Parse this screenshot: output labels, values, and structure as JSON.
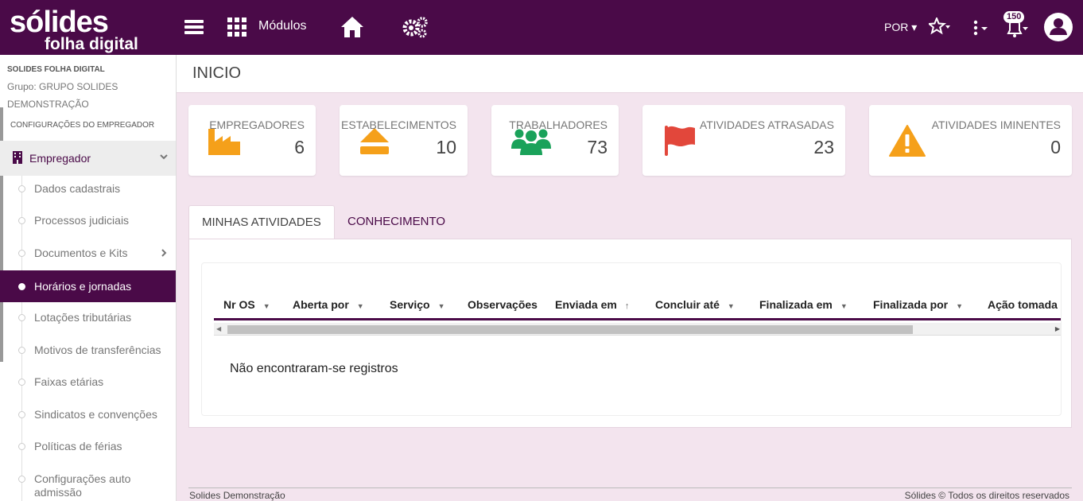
{
  "header": {
    "logo_line1": "sólides",
    "logo_line2": "folha digital",
    "modules_label": "Módulos",
    "language": "POR",
    "notifications_count": "150"
  },
  "sidebar": {
    "company": "SOLIDES FOLHA DIGITAL",
    "group": "Grupo: GRUPO SOLIDES DEMONSTRAÇÃO",
    "config_label": "CONFIGURAÇÕES DO EMPREGADOR",
    "section_label": "Empregador",
    "items": [
      {
        "label": "Dados cadastrais"
      },
      {
        "label": "Processos judiciais"
      },
      {
        "label": "Documentos e Kits"
      },
      {
        "label": "Horários e jornadas"
      },
      {
        "label": "Lotações tributárias"
      },
      {
        "label": "Motivos de transferências"
      },
      {
        "label": "Faixas etárias"
      },
      {
        "label": "Sindicatos e convenções"
      },
      {
        "label": "Políticas de férias"
      },
      {
        "label": "Configurações auto admissão"
      }
    ]
  },
  "page": {
    "title": "INICIO"
  },
  "cards": [
    {
      "title": "EMPREGADORES",
      "value": "6",
      "icon": "factory-icon",
      "color": "#f5a01a"
    },
    {
      "title": "ESTABELECIMENTOS",
      "value": "10",
      "icon": "eject-icon",
      "color": "#f5a01a"
    },
    {
      "title": "TRABALHADORES",
      "value": "73",
      "icon": "users-icon",
      "color": "#1aa25a"
    },
    {
      "title": "ATIVIDADES ATRASADAS",
      "value": "23",
      "icon": "flag-icon",
      "color": "#e2473b"
    },
    {
      "title": "ATIVIDADES IMINENTES",
      "value": "0",
      "icon": "warning-icon",
      "color": "#f5a01a"
    }
  ],
  "tabs": [
    {
      "label": "MINHAS ATIVIDADES"
    },
    {
      "label": "CONHECIMENTO"
    }
  ],
  "table": {
    "columns": [
      {
        "label": "Nr OS",
        "sort": "▼"
      },
      {
        "label": "Aberta por",
        "sort": "▼"
      },
      {
        "label": "Serviço",
        "sort": "▼"
      },
      {
        "label": "Observações",
        "sort": ""
      },
      {
        "label": "Enviada em",
        "sort": "↑"
      },
      {
        "label": "Concluir até",
        "sort": "▼"
      },
      {
        "label": "Finalizada em",
        "sort": "▼"
      },
      {
        "label": "Finalizada por",
        "sort": "▼"
      },
      {
        "label": "Ação tomada",
        "sort": ""
      }
    ],
    "empty_message": "Não encontraram-se registros"
  },
  "footer": {
    "left": "Solides Demonstração",
    "right": "Sólides © Todos os direitos reservados"
  },
  "colors": {
    "brand": "#4a0a48",
    "background": "#f3e4ee"
  }
}
